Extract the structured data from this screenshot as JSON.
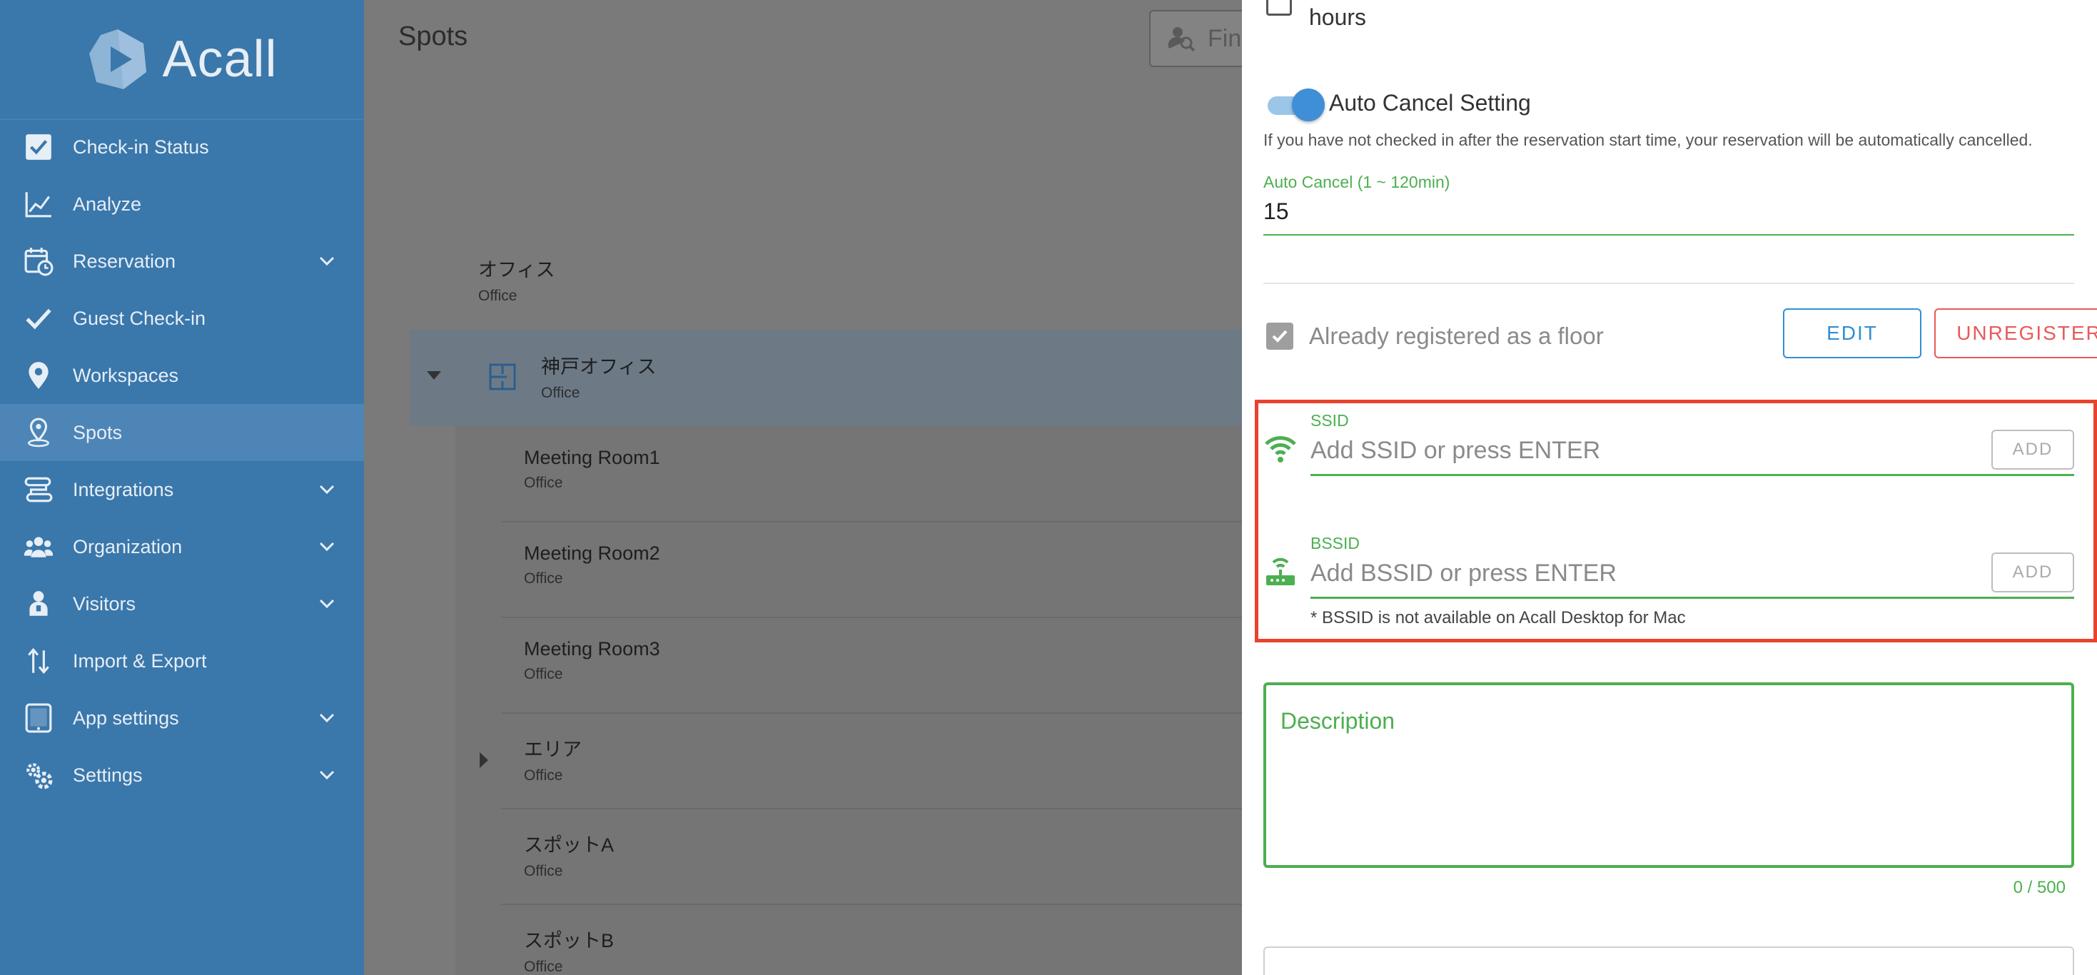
{
  "app": {
    "name": "Acall"
  },
  "sidebar": {
    "items": [
      {
        "label": "Check-in Status",
        "icon": "checkbox-icon",
        "expandable": false
      },
      {
        "label": "Analyze",
        "icon": "chart-line-icon",
        "expandable": false
      },
      {
        "label": "Reservation",
        "icon": "calendar-clock-icon",
        "expandable": true
      },
      {
        "label": "Guest Check-in",
        "icon": "check-icon",
        "expandable": false
      },
      {
        "label": "Workspaces",
        "icon": "map-pin-icon",
        "expandable": false
      },
      {
        "label": "Spots",
        "icon": "spot-pin-icon",
        "expandable": false,
        "active": true
      },
      {
        "label": "Integrations",
        "icon": "integrations-icon",
        "expandable": true
      },
      {
        "label": "Organization",
        "icon": "people-icon",
        "expandable": true
      },
      {
        "label": "Visitors",
        "icon": "visitor-icon",
        "expandable": true
      },
      {
        "label": "Import & Export",
        "icon": "import-export-icon",
        "expandable": false
      },
      {
        "label": "App settings",
        "icon": "tablet-icon",
        "expandable": true
      },
      {
        "label": "Settings",
        "icon": "gears-icon",
        "expandable": true
      }
    ]
  },
  "main": {
    "title": "Spots",
    "search_placeholder": "Fin",
    "tree": [
      {
        "title": "オフィス",
        "subtitle": "Office",
        "level": 0
      },
      {
        "title": "神戸オフィス",
        "subtitle": "Office",
        "level": 1,
        "expanded": true
      },
      {
        "title": "Meeting Room1",
        "subtitle": "Office",
        "level": 2
      },
      {
        "title": "Meeting Room2",
        "subtitle": "Office",
        "level": 2
      },
      {
        "title": "Meeting Room3",
        "subtitle": "Office",
        "level": 2
      },
      {
        "title": "エリア",
        "subtitle": "Office",
        "level": 2,
        "collapsed": true
      },
      {
        "title": "スポットA",
        "subtitle": "Office",
        "level": 2
      },
      {
        "title": "スポットB",
        "subtitle": "Office",
        "level": 2
      }
    ]
  },
  "panel": {
    "hours_text": "hours",
    "auto_cancel": {
      "label": "Auto Cancel Setting",
      "enabled": true,
      "description": "If you have not checked in after the reservation start time, your reservation will be automatically cancelled.",
      "field_label": "Auto Cancel (1 ~ 120min)",
      "value": "15"
    },
    "floor": {
      "label": "Already registered as a floor",
      "checked": true,
      "edit_label": "EDIT",
      "unregister_label": "UNREGISTER"
    },
    "ssid": {
      "label": "SSID",
      "placeholder": "Add SSID or press ENTER",
      "add_label": "ADD"
    },
    "bssid": {
      "label": "BSSID",
      "placeholder": "Add BSSID or press ENTER",
      "add_label": "ADD",
      "note": "* BSSID is not available on Acall Desktop for Mac"
    },
    "description": {
      "label": "Description",
      "counter": "0 / 500"
    }
  },
  "colors": {
    "sidebar": "#3a77ab",
    "primary": "#2f8fd6",
    "success": "#4caf50",
    "danger": "#e85a5a",
    "highlight": "#e8432f"
  }
}
